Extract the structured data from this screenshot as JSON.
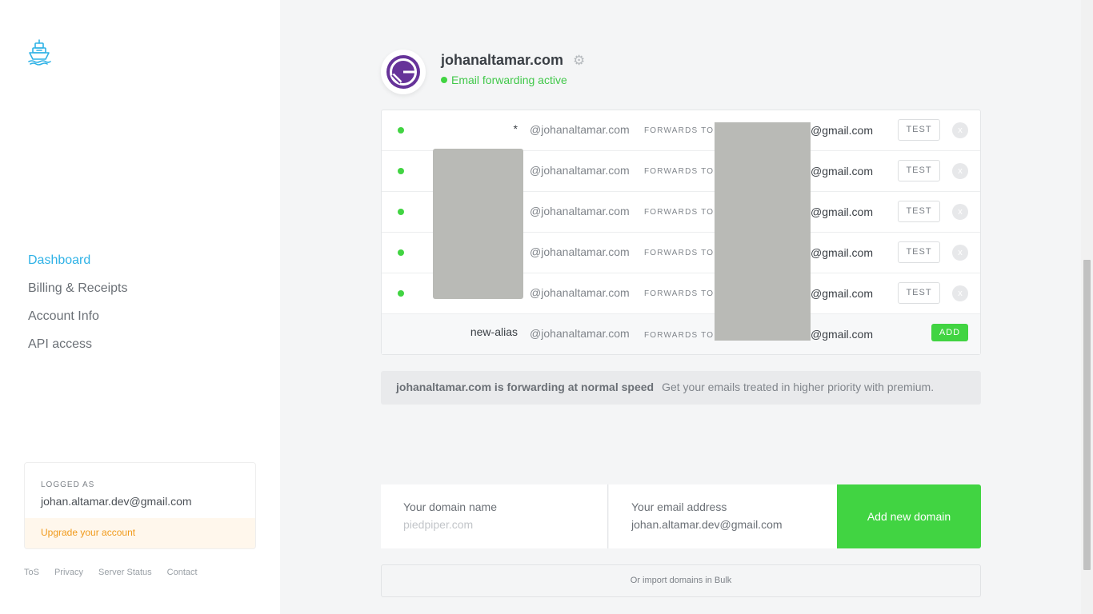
{
  "sidebar": {
    "logo_icon": "ship-icon",
    "nav": [
      {
        "label": "Dashboard",
        "active": true
      },
      {
        "label": "Billing & Receipts",
        "active": false
      },
      {
        "label": "Account Info",
        "active": false
      },
      {
        "label": "API access",
        "active": false
      }
    ],
    "account": {
      "logged_label": "LOGGED AS",
      "email": "johan.altamar.dev@gmail.com",
      "upgrade_label": "Upgrade your account"
    },
    "footer_links": [
      "ToS",
      "Privacy",
      "Server Status",
      "Contact"
    ]
  },
  "domain": {
    "name": "johanaltamar.com",
    "avatar_icon": "gatsby-logo-icon",
    "status": "Email forwarding active",
    "settings_icon": "gear-icon"
  },
  "aliases": {
    "domain_suffix": "@johanaltamar.com",
    "forwards_label": "FORWARDS TO",
    "target_suffix": "@gmail.com",
    "test_label": "TEST",
    "delete_label": "x",
    "rows": [
      {
        "alias": "*"
      },
      {
        "alias": ""
      },
      {
        "alias": ""
      },
      {
        "alias": ""
      },
      {
        "alias": ""
      }
    ],
    "new_row": {
      "alias_value": "new-alias",
      "add_label": "ADD"
    }
  },
  "notice": {
    "strong": "johanaltamar.com is forwarding at normal speed",
    "light": "Get your emails treated in higher priority with premium."
  },
  "add_domain": {
    "domain_label": "Your domain name",
    "domain_placeholder": "piedpiper.com",
    "email_label": "Your email address",
    "email_value": "johan.altamar.dev@gmail.com",
    "submit_label": "Add new domain",
    "bulk_label": "Or import domains in Bulk"
  },
  "colors": {
    "accent": "#2fb2e6",
    "success": "#41d442",
    "warning": "#f09a1b"
  }
}
